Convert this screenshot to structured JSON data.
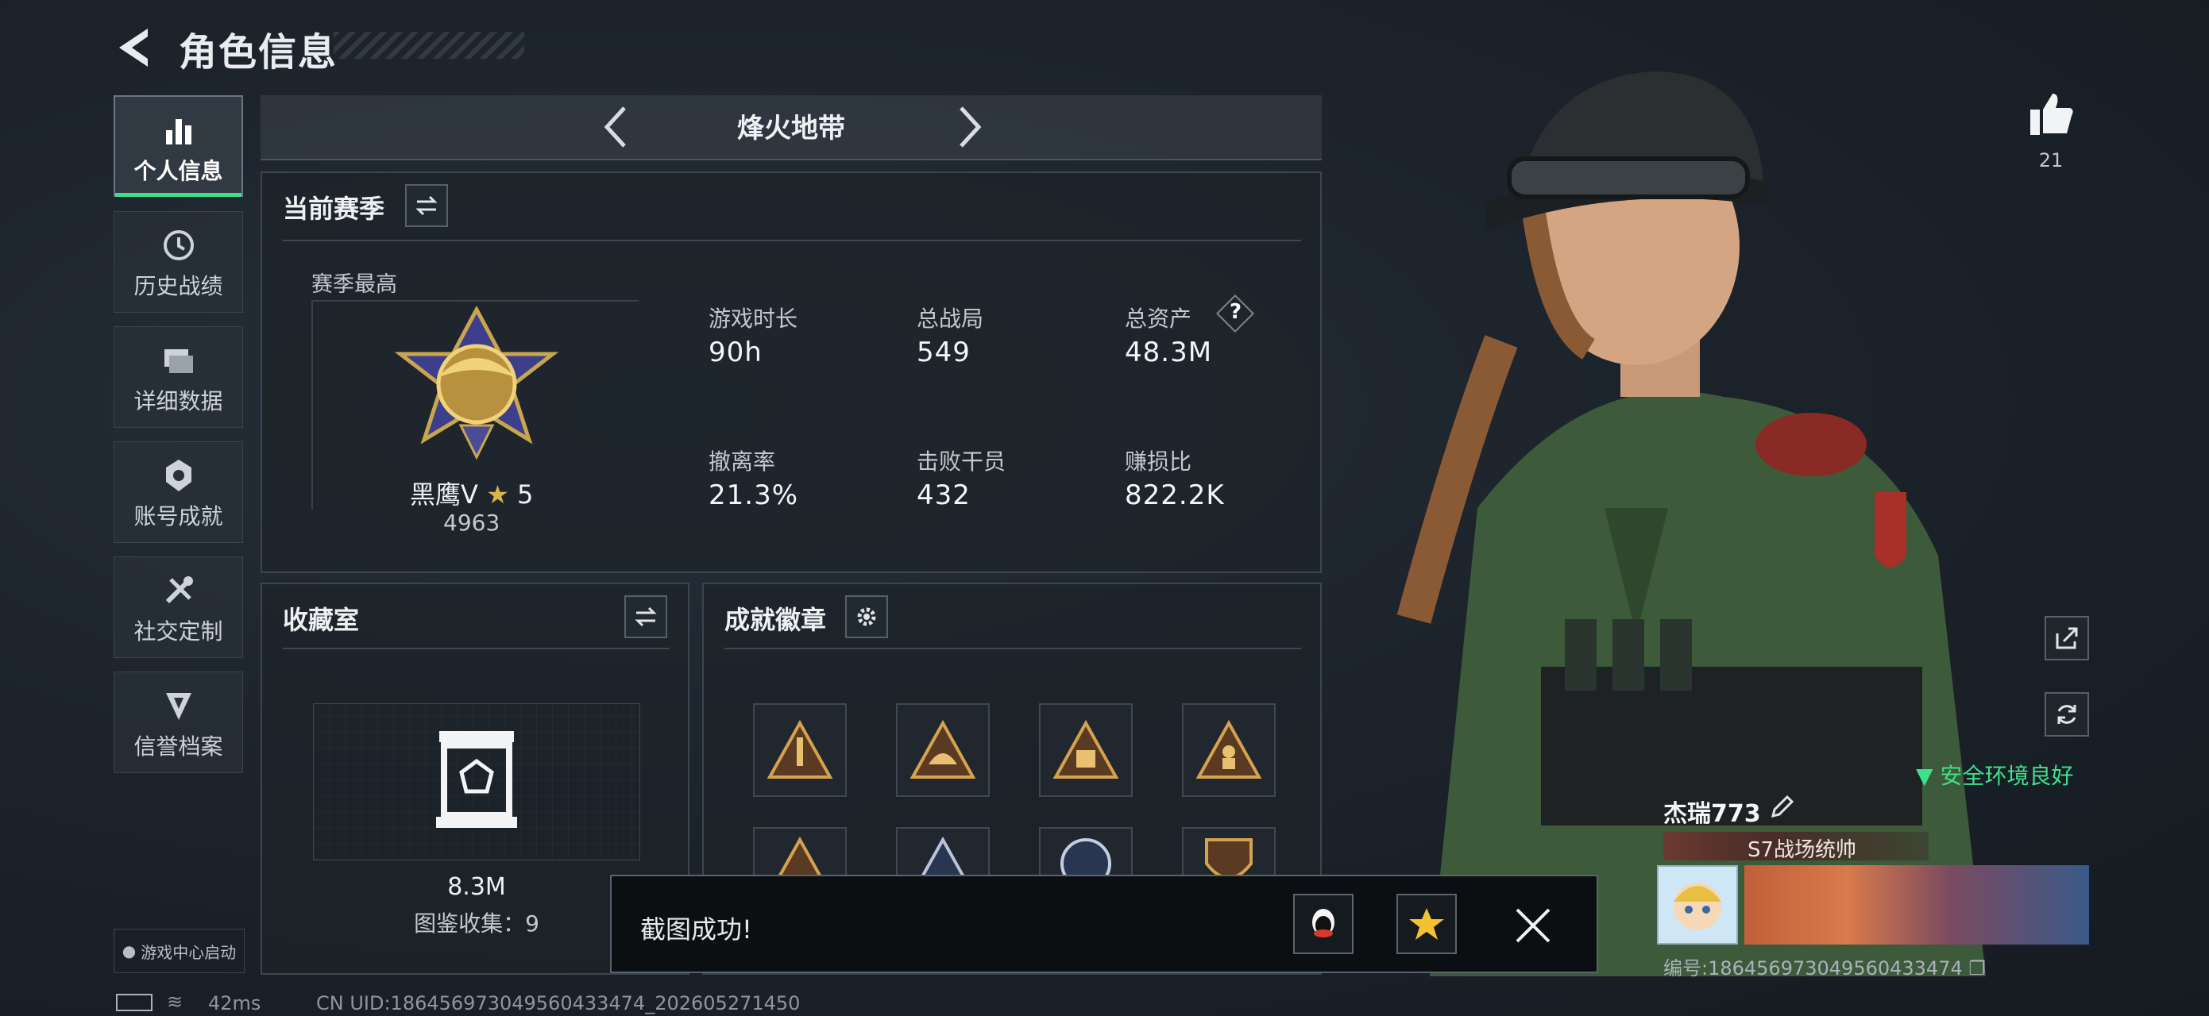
{
  "header": {
    "title": "角色信息",
    "back_icon": "back-arrow-icon"
  },
  "sidebar": {
    "items": [
      {
        "label": "个人信息",
        "icon": "bar-chart-icon",
        "active": true
      },
      {
        "label": "历史战绩",
        "icon": "history-clock-icon",
        "active": false
      },
      {
        "label": "详细数据",
        "icon": "folder-stack-icon",
        "active": false
      },
      {
        "label": "账号成就",
        "icon": "achievement-medal-icon",
        "active": false
      },
      {
        "label": "社交定制",
        "icon": "tools-icon",
        "active": false
      },
      {
        "label": "信誉档案",
        "icon": "shield-badge-icon",
        "active": false
      }
    ],
    "game_center": "游戏中心启动"
  },
  "mode": {
    "label": "烽火地带"
  },
  "season": {
    "title": "当前赛季",
    "best_label": "赛季最高",
    "rank_name": "黑鹰V",
    "rank_stars": "5",
    "rank_score": "4963",
    "stats": [
      {
        "label": "游戏时长",
        "value": "90h"
      },
      {
        "label": "总战局",
        "value": "549"
      },
      {
        "label": "总资产",
        "value": "48.3M",
        "help": "?"
      },
      {
        "label": "撤离率",
        "value": "21.3%"
      },
      {
        "label": "击败干员",
        "value": "432"
      },
      {
        "label": "赚损比",
        "value": "822.2K"
      }
    ]
  },
  "collection": {
    "title": "收藏室",
    "value": "8.3M",
    "collect_label": "图鉴收集：9"
  },
  "achievements": {
    "title": "成就徽章"
  },
  "right": {
    "likes": "21",
    "safe_env": "安全环境良好",
    "player_name": "杰瑞773",
    "player_title": "S7战场统帅",
    "player_id": "编号:1864569730495604334​74"
  },
  "toast": {
    "text": "截图成功!"
  },
  "footer": {
    "ping": "42ms",
    "uid": "CN UID:18645697304956043347​4_202605271450"
  },
  "colors": {
    "accent_green": "#3ee08a",
    "panel_border": "#3c4650",
    "background": "#1c232b"
  }
}
